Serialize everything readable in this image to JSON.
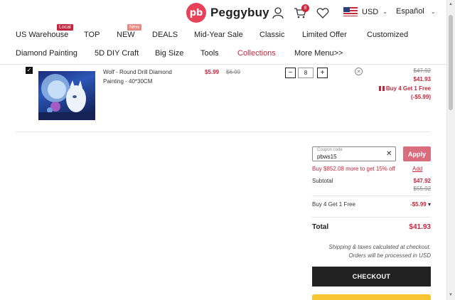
{
  "header": {
    "logo_mark": "pb",
    "logo_text": "Peggybuy",
    "cart_count": "8",
    "currency": "USD",
    "language": "Español"
  },
  "nav": {
    "row1": [
      {
        "label": "US Warehouse",
        "badge": "Local"
      },
      {
        "label": "TOP"
      },
      {
        "label": "NEW",
        "badge": "New"
      },
      {
        "label": "DEALS"
      },
      {
        "label": "Mid-Year Sale"
      },
      {
        "label": "Classic"
      },
      {
        "label": "Limited Offer"
      },
      {
        "label": "Customized"
      }
    ],
    "row2": [
      {
        "label": "Diamond Painting"
      },
      {
        "label": "5D DIY Craft"
      },
      {
        "label": "Big Size"
      },
      {
        "label": "Tools"
      },
      {
        "label": "Collections",
        "active": true
      },
      {
        "label": "More Menu>>"
      }
    ]
  },
  "cart_item": {
    "name": "Wolf - Round Drill Diamond Painting - 40*30CM",
    "price_sale": "$5.99",
    "price_original": "$6.99",
    "quantity": "8",
    "qty_minus": "−",
    "qty_plus": "+",
    "row_original": "$47.92",
    "row_subtotal": "$41.93",
    "promo_line1": "Buy 4 Get 1 Free",
    "promo_line2": "(-$5.99)"
  },
  "summary": {
    "coupon_label": "Coupon code",
    "coupon_value": "pbws15",
    "apply_label": "Apply",
    "coupon_message": "Buy $852.08 more to get 15% off",
    "add_label": "Add",
    "subtotal_label": "Subtotal",
    "subtotal_value": "$47.92",
    "subtotal_original": "$55.92",
    "promo_label": "Buy 4 Get 1 Free",
    "promo_value": "-$5.99",
    "total_label": "Total",
    "total_value": "$41.93",
    "note1": "Shipping & taxes calculated at checkout.",
    "note2": "Orders will be processed in USD",
    "checkout_label": "CHECKOUT"
  },
  "colors": {
    "accent": "#c2273e",
    "brand": "#e8425a",
    "apply": "#d96d7e",
    "checkout": "#222222",
    "paypal": "#f7c531"
  }
}
